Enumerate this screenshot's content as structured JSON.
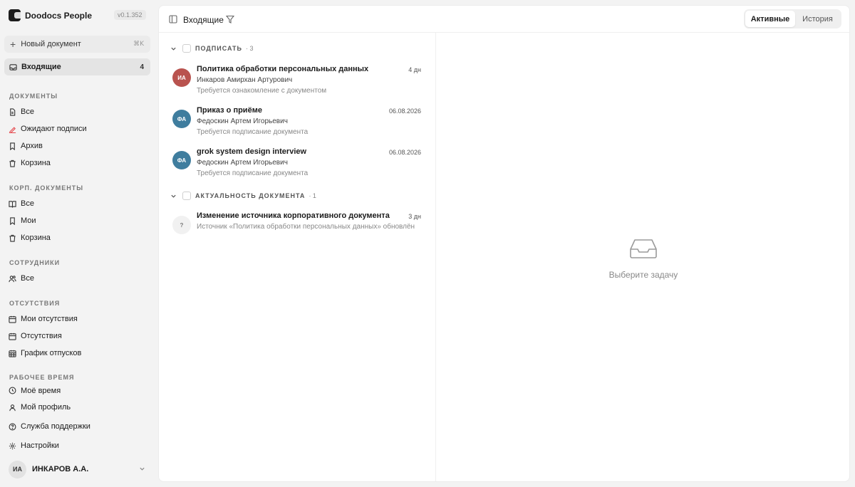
{
  "app": {
    "name": "Doodocs People",
    "version": "v0.1.352"
  },
  "sidebar": {
    "new_document": {
      "label": "Новый документ",
      "shortcut": "⌘K"
    },
    "inbox": {
      "label": "Входящие",
      "count": "4"
    },
    "sections": [
      {
        "title": "ДОКУМЕНТЫ",
        "items": [
          {
            "label": "Все",
            "icon": "document-icon"
          },
          {
            "label": "Ожидают подписи",
            "icon": "signature-icon",
            "accent": "#e5484d"
          },
          {
            "label": "Архив",
            "icon": "bookmark-icon"
          },
          {
            "label": "Корзина",
            "icon": "trash-icon"
          }
        ]
      },
      {
        "title": "КОРП. ДОКУМЕНТЫ",
        "items": [
          {
            "label": "Все",
            "icon": "book-icon"
          },
          {
            "label": "Мои",
            "icon": "bookmark-icon"
          },
          {
            "label": "Корзина",
            "icon": "trash-icon"
          }
        ]
      },
      {
        "title": "СОТРУДНИКИ",
        "items": [
          {
            "label": "Все",
            "icon": "users-icon"
          }
        ]
      },
      {
        "title": "ОТСУТСТВИЯ",
        "items": [
          {
            "label": "Мои отсутствия",
            "icon": "calendar-icon"
          },
          {
            "label": "Отсутствия",
            "icon": "calendar-icon"
          },
          {
            "label": "График отпусков",
            "icon": "calendar-grid-icon"
          }
        ]
      },
      {
        "title": "РАБОЧЕЕ ВРЕМЯ",
        "items": [
          {
            "label": "Моё время",
            "icon": "clock-icon"
          }
        ]
      }
    ],
    "footer": {
      "profile": "Мой профиль",
      "support": "Служба поддержки",
      "settings": "Настройки"
    },
    "user": {
      "initials": "ИА",
      "name": "ИНКАРОВ А.А."
    }
  },
  "topbar": {
    "title": "Входящие",
    "tabs": [
      {
        "label": "Активные",
        "active": true
      },
      {
        "label": "История",
        "active": false
      }
    ]
  },
  "groups": [
    {
      "title": "ПОДПИСАТЬ",
      "count": "· 3",
      "tasks": [
        {
          "initials": "ИА",
          "avatar_color": "#b9534f",
          "title": "Политика обработки персональных данных",
          "date": "4 дн",
          "author": "Инкаров Амирхан Артурович",
          "status": "Требуется ознакомление с документом"
        },
        {
          "initials": "ФА",
          "avatar_color": "#3f7d9e",
          "title": "Приказ о приёме",
          "date": "06.08.2026",
          "author": "Федоскин Артем Игорьевич",
          "status": "Требуется подписание документа"
        },
        {
          "initials": "ФА",
          "avatar_color": "#3f7d9e",
          "title": "grok system design interview",
          "date": "06.08.2026",
          "author": "Федоскин Артем Игорьевич",
          "status": "Требуется подписание документа"
        }
      ]
    },
    {
      "title": "АКТУАЛЬНОСТЬ ДОКУМЕНТА",
      "count": "· 1",
      "tasks": [
        {
          "initials": "?",
          "title": "Изменение источника корпоративного документа",
          "date": "3 дн",
          "description": "Источник «Политика обработки персональных данных» обновлён"
        }
      ]
    }
  ],
  "detail": {
    "empty_text": "Выберите задачу",
    "icon": "inbox-tray-icon"
  }
}
